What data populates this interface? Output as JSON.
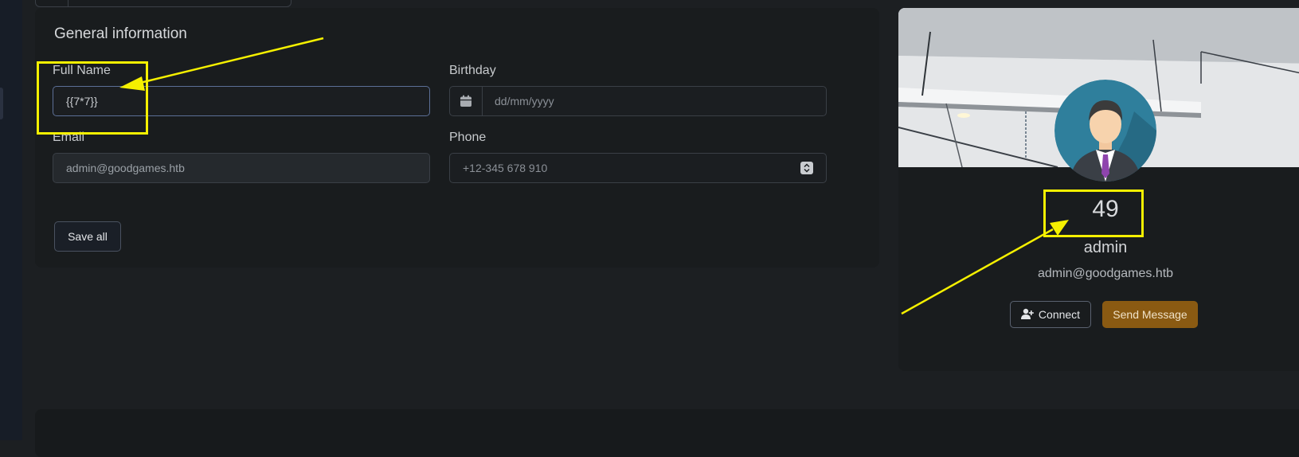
{
  "general": {
    "title": "General information",
    "full_name_label": "Full Name",
    "full_name_value": "{{7*7}}",
    "birthday_label": "Birthday",
    "birthday_placeholder": "dd/mm/yyyy",
    "email_label": "Email",
    "email_value": "admin@goodgames.htb",
    "phone_label": "Phone",
    "phone_placeholder": "+12-345 678 910",
    "save_label": "Save all"
  },
  "profile": {
    "number": "49",
    "name": "admin",
    "email": "admin@goodgames.htb",
    "connect_label": "Connect",
    "message_label": "Send Message"
  },
  "icons": {
    "calendar": "calendar-icon",
    "spinner": "number-spinner-icon",
    "add_user": "user-plus-icon",
    "avatar": "businessman-avatar"
  },
  "colors": {
    "highlight": "#f5f000",
    "message_button": "#8a5a12",
    "focus_border": "#5c6f96"
  }
}
